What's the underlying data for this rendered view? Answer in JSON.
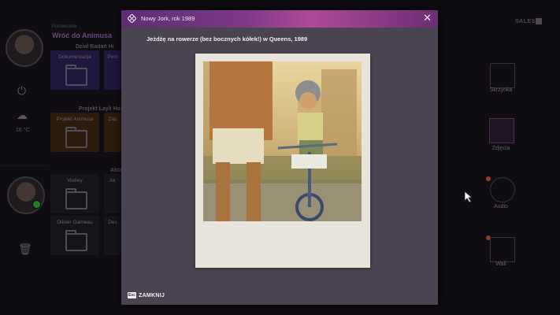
{
  "background": {
    "section_small": "Porównanie",
    "section_title": "Wróć do Animusa",
    "groups": [
      {
        "title": "Dział Badań Hi",
        "tiles": [
          "Dokumentacja",
          "Porc"
        ]
      },
      {
        "title": "Projekt Layli Hassa",
        "tiles": [
          "Projekt Animusa",
          "Zap"
        ]
      },
      {
        "title": "Akta",
        "tiles": [
          "Welley",
          "Ak",
          "Olivier Garneau",
          "Des"
        ]
      }
    ],
    "temperature": "16 °C",
    "top_right": "SALES",
    "right_items": [
      {
        "label": "Skrzynka",
        "icon": "inbox-icon"
      },
      {
        "label": "Zdjęcia",
        "icon": "photos-icon"
      },
      {
        "label": "Audio",
        "icon": "play-icon"
      },
      {
        "label": "Wall",
        "icon": "screens-icon"
      }
    ]
  },
  "modal": {
    "title": "Nowy Jork, rok 1989",
    "caption": "Jeżdżę na rowerze (bez bocznych kółek!) w Queens, 1989",
    "close_label": "ZAMKNIJ",
    "close_key": "Esc"
  },
  "colors": {
    "header_gradient": [
      "#5c2d72",
      "#b04a98"
    ],
    "modal_bg": "#4a4352",
    "online": "#2fa83b"
  }
}
